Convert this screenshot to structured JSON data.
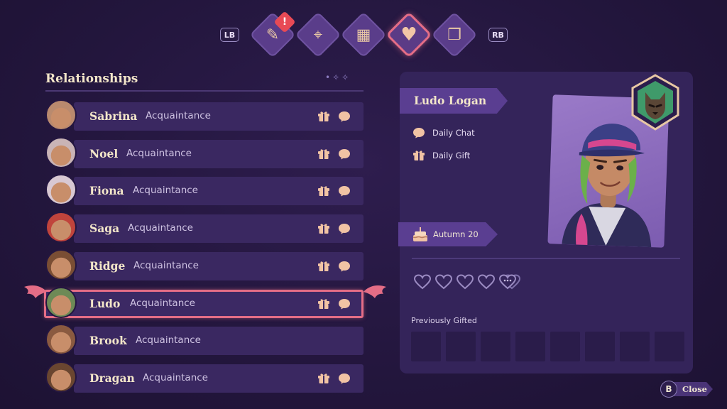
{
  "tabs": {
    "left_bumper": "LB",
    "right_bumper": "RB",
    "alert_mark": "!",
    "items": [
      {
        "icon": "quest-scroll-icon",
        "glyph": "✎",
        "active": false,
        "has_alert": true
      },
      {
        "icon": "map-icon",
        "glyph": "⌖",
        "active": false
      },
      {
        "icon": "calendar-icon",
        "glyph": "▦",
        "active": false
      },
      {
        "icon": "heart-icon",
        "glyph": "♥",
        "active": true
      },
      {
        "icon": "book-icon",
        "glyph": "❐",
        "active": false
      }
    ]
  },
  "relationships": {
    "title": "Relationships",
    "rows": [
      {
        "name": "Sabrina",
        "status": "Acquaintance",
        "gift": true,
        "chat": true,
        "selected": false,
        "avatar_color": "#b98a6e"
      },
      {
        "name": "Noel",
        "status": "Acquaintance",
        "gift": true,
        "chat": true,
        "selected": false,
        "avatar_color": "#c9b4b6"
      },
      {
        "name": "Fiona",
        "status": "Acquaintance",
        "gift": true,
        "chat": true,
        "selected": false,
        "avatar_color": "#d8c8d2"
      },
      {
        "name": "Saga",
        "status": "Acquaintance",
        "gift": true,
        "chat": true,
        "selected": false,
        "avatar_color": "#c0443c"
      },
      {
        "name": "Ridge",
        "status": "Acquaintance",
        "gift": true,
        "chat": true,
        "selected": false,
        "avatar_color": "#7a4e34"
      },
      {
        "name": "Ludo",
        "status": "Acquaintance",
        "gift": true,
        "chat": true,
        "selected": true,
        "avatar_color": "#6d8a56"
      },
      {
        "name": "Brook",
        "status": "Acquaintance",
        "gift": false,
        "chat": false,
        "selected": false,
        "avatar_color": "#8a5a40"
      },
      {
        "name": "Dragan",
        "status": "Acquaintance",
        "gift": true,
        "chat": true,
        "selected": false,
        "avatar_color": "#6a4630"
      }
    ]
  },
  "detail": {
    "name": "Ludo Logan",
    "tasks": {
      "chat": "Daily Chat",
      "gift": "Daily Gift"
    },
    "birthday": "Autumn 20",
    "hearts": 5,
    "previously_gifted_label": "Previously Gifted",
    "gift_slots": 8
  },
  "close": {
    "button": "B",
    "label": "Close"
  },
  "colors": {
    "accent": "#e46d86",
    "panel": "#34245a",
    "row": "#3a2861",
    "icon_peach": "#f1c3a4"
  }
}
